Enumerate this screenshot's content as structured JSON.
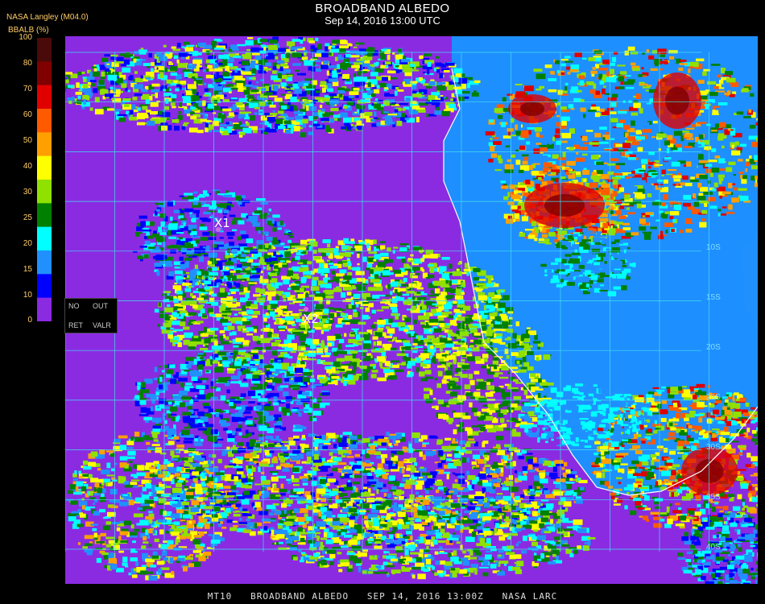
{
  "title": "BROADBAND ALBEDO",
  "subtitle": "Sep 14, 2016 13:00 UTC",
  "source": "NASA Langley (M04.0)",
  "unit": "BBALB (%)",
  "legend": {
    "ticks": [
      "100",
      "80",
      "70",
      "60",
      "50",
      "40",
      "30",
      "25",
      "20",
      "15",
      "10",
      "0"
    ],
    "colors": [
      "#4a0a0a",
      "#800000",
      "#e00000",
      "#ff5a00",
      "#ffa000",
      "#ffff00",
      "#90e000",
      "#008000",
      "#00ffff",
      "#2090ff",
      "#0000ff",
      "#8a2be2"
    ]
  },
  "panel": {
    "no": "NO",
    "out": "OUT",
    "ret": "RET",
    "valr": "VALR"
  },
  "markers": [
    {
      "label": "X1"
    },
    {
      "label": "X2"
    }
  ],
  "lat_labels": [
    "10S",
    "15S",
    "20S",
    "25S",
    "30S",
    "35S",
    "40S"
  ],
  "footer": "MT10   BROADBAND ALBEDO   SEP 14, 2016 13:00Z   NASA LARC",
  "colors": {
    "ocean": "#8a2be2",
    "land_clear": "#1e8fff",
    "grid": "#40e0f0",
    "coast": "#ffffff"
  }
}
